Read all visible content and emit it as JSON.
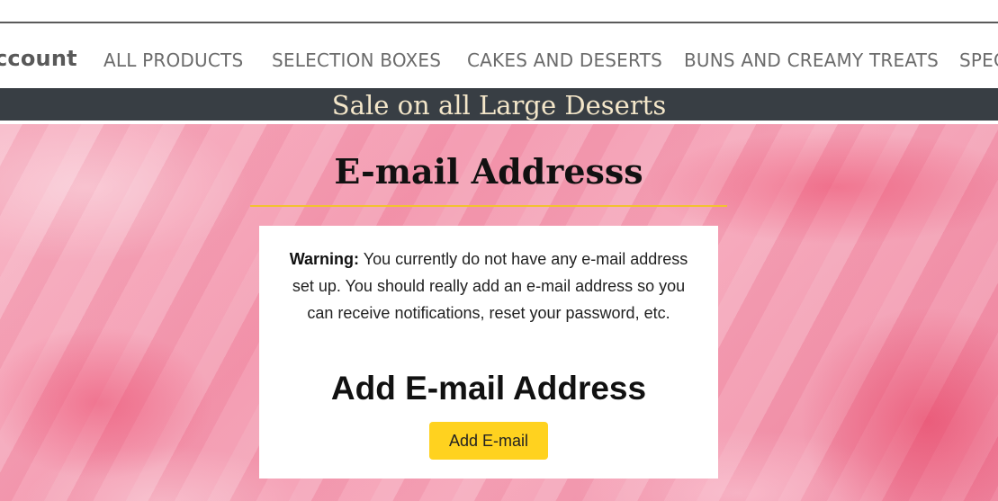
{
  "nav": {
    "account_label": "ccount",
    "items": [
      "ALL PRODUCTS",
      "SELECTION BOXES",
      "CAKES AND DESERTS",
      "BUNS AND CREAMY TREATS",
      "SPEC"
    ]
  },
  "banner": {
    "text": "Sale on all Large Deserts"
  },
  "hero": {
    "title": "E-mail Addresss"
  },
  "card": {
    "warning_label": "Warning:",
    "warning_text": " You currently do not have any e-mail address set up. You should really add an e-mail address so you can receive notifications, reset your password, etc.",
    "heading": "Add E-mail Address",
    "button_label": "Add E-mail"
  },
  "colors": {
    "banner_bg": "#383e44",
    "banner_text": "#f3e6c9",
    "accent_button": "#ffd21f",
    "title_rule": "#f2c230"
  }
}
